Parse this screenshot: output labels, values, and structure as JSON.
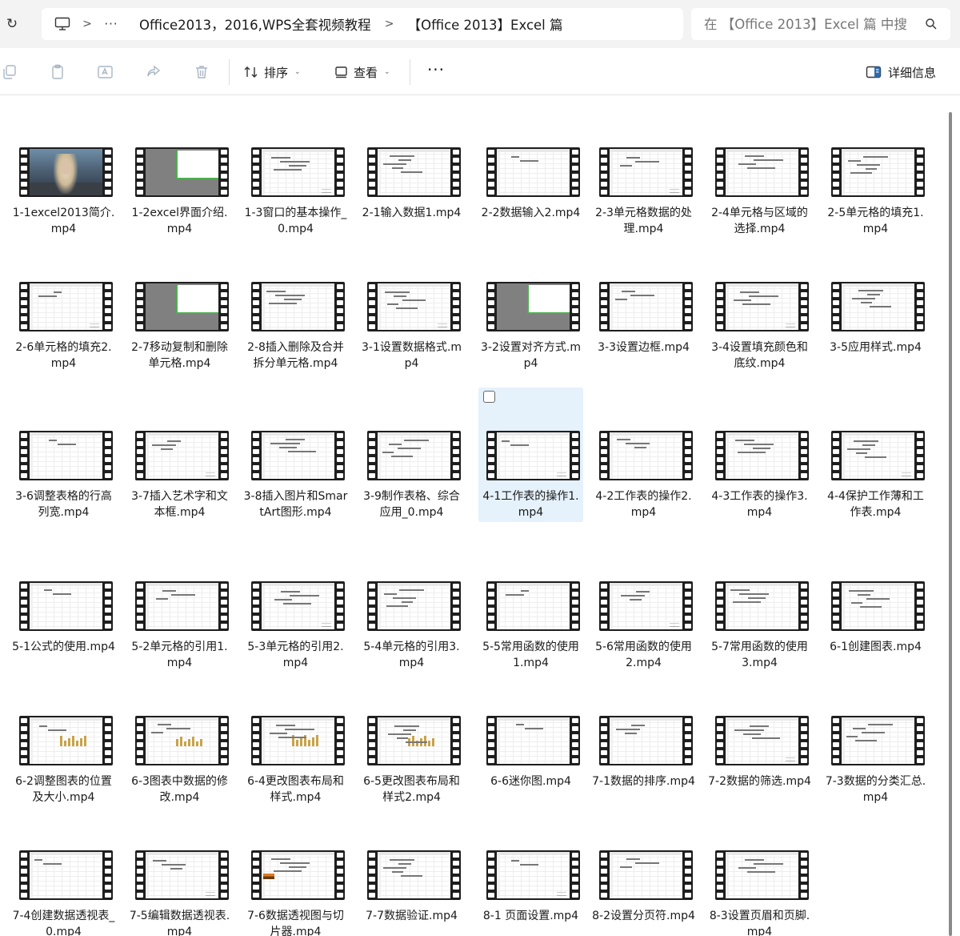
{
  "address": {
    "overflow_label": "···",
    "crumbs": [
      "Office2013，2016,WPS全套视频教程",
      "【Office 2013】Excel 篇"
    ]
  },
  "search": {
    "placeholder": "在 【Office 2013】Excel 篇 中搜"
  },
  "toolbar": {
    "sort_label": "排序",
    "view_label": "查看",
    "more_label": "···",
    "details_label": "详细信息"
  },
  "files": [
    {
      "name": "1-1excel2013简介.mp4",
      "thumb": "movie"
    },
    {
      "name": "1-2excel界面介绍.mp4",
      "thumb": "grey"
    },
    {
      "name": "1-3窗口的基本操作_0.mp4",
      "thumb": "sheet"
    },
    {
      "name": "2-1输入数据1.mp4",
      "thumb": "sheet"
    },
    {
      "name": "2-2数据输入2.mp4",
      "thumb": "sheet"
    },
    {
      "name": "2-3单元格数据的处理.mp4",
      "thumb": "sheet"
    },
    {
      "name": "2-4单元格与区域的选择.mp4",
      "thumb": "sheet"
    },
    {
      "name": "2-5单元格的填充1.mp4",
      "thumb": "sheet"
    },
    {
      "name": "2-6单元格的填充2.mp4",
      "thumb": "sheet"
    },
    {
      "name": "2-7移动复制和删除单元格.mp4",
      "thumb": "grey"
    },
    {
      "name": "2-8插入删除及合并拆分单元格.mp4",
      "thumb": "sheet"
    },
    {
      "name": "3-1设置数据格式.mp4",
      "thumb": "sheet"
    },
    {
      "name": "3-2设置对齐方式.mp4",
      "thumb": "grey"
    },
    {
      "name": "3-3设置边框.mp4",
      "thumb": "sheet"
    },
    {
      "name": "3-4设置填充颜色和底纹.mp4",
      "thumb": "sheet"
    },
    {
      "name": "3-5应用样式.mp4",
      "thumb": "sheet"
    },
    {
      "name": "3-6调整表格的行高列宽.mp4",
      "thumb": "sheet"
    },
    {
      "name": "3-7插入艺术字和文本框.mp4",
      "thumb": "sheet"
    },
    {
      "name": "3-8插入图片和SmartArt图形.mp4",
      "thumb": "sheet"
    },
    {
      "name": "3-9制作表格、综合应用_0.mp4",
      "thumb": "sheet"
    },
    {
      "name": "4-1工作表的操作1.mp4",
      "thumb": "sheet",
      "selected": true
    },
    {
      "name": "4-2工作表的操作2.mp4",
      "thumb": "sheet"
    },
    {
      "name": "4-3工作表的操作3.mp4",
      "thumb": "sheet"
    },
    {
      "name": "4-4保护工作薄和工作表.mp4",
      "thumb": "sheet"
    },
    {
      "name": "5-1公式的使用.mp4",
      "thumb": "sheet"
    },
    {
      "name": "5-2单元格的引用1.mp4",
      "thumb": "sheet"
    },
    {
      "name": "5-3单元格的引用2.mp4",
      "thumb": "sheet"
    },
    {
      "name": "5-4单元格的引用3.mp4",
      "thumb": "sheet"
    },
    {
      "name": "5-5常用函数的使用1.mp4",
      "thumb": "sheet"
    },
    {
      "name": "5-6常用函数的使用2.mp4",
      "thumb": "sheet"
    },
    {
      "name": "5-7常用函数的使用3.mp4",
      "thumb": "sheet"
    },
    {
      "name": "6-1创建图表.mp4",
      "thumb": "sheet"
    },
    {
      "name": "6-2调整图表的位置及大小.mp4",
      "thumb": "chart"
    },
    {
      "name": "6-3图表中数据的修改.mp4",
      "thumb": "chart"
    },
    {
      "name": "6-4更改图表布局和样式.mp4",
      "thumb": "chart"
    },
    {
      "name": "6-5更改图表布局和样式2.mp4",
      "thumb": "chart"
    },
    {
      "name": "6-6迷你图.mp4",
      "thumb": "sheet"
    },
    {
      "name": "7-1数据的排序.mp4",
      "thumb": "sheet"
    },
    {
      "name": "7-2数据的筛选.mp4",
      "thumb": "sheet"
    },
    {
      "name": "7-3数据的分类汇总.mp4",
      "thumb": "sheet"
    },
    {
      "name": "7-4创建数据透视表_0.mp4",
      "thumb": "sheet"
    },
    {
      "name": "7-5编辑数据透视表.mp4",
      "thumb": "sheet"
    },
    {
      "name": "7-6数据透视图与切片器.mp4",
      "thumb": "slicer"
    },
    {
      "name": "7-7数据验证.mp4",
      "thumb": "sheet"
    },
    {
      "name": "8-1 页面设置.mp4",
      "thumb": "sheet"
    },
    {
      "name": "8-2设置分页符.mp4",
      "thumb": "sheet"
    },
    {
      "name": "8-3设置页眉和页脚.mp4",
      "thumb": "sheet"
    }
  ]
}
